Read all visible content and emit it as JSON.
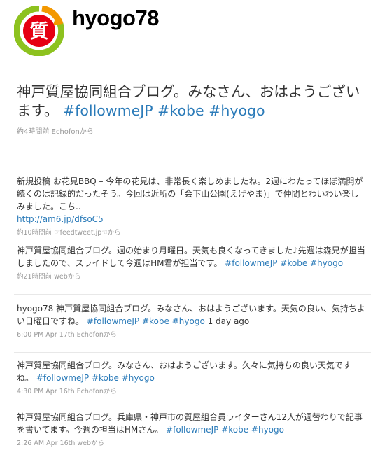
{
  "profile": {
    "screen_name": "hyogo78",
    "avatar_char": "質",
    "colors": {
      "ring_green": "#8dc21f",
      "ring_orange": "#f39800",
      "center_red": "#e60012"
    }
  },
  "featured": {
    "text_prefix": "神戸質屋協同組合ブログ。みなさん、おはようございます。",
    "tags": [
      "#followmeJP",
      "#kobe",
      "#hyogo"
    ],
    "meta": "約4時間前 Echofonから"
  },
  "tweets": [
    {
      "text": "新規投稿 お花見BBQ – 今年の花見は、非常長く楽しめましたね。2週にわたってほぼ満開が続くのは記録的だったそう。今回は近所の「会下山公園(えげやま)」で仲間とわいわい楽しみました。こち..",
      "link": "http://am6.jp/dfsoC5",
      "meta": "約10時間前 ☞feedtweet.jp☜から"
    },
    {
      "text": "神戸質屋協同組合ブログ。週の始まり月曜日。天気も良くなってきました♪先週は森兄が担当しましたので、スライドして今週はHM君が担当です。",
      "tags": [
        "#followmeJP",
        "#kobe",
        "#hyogo"
      ],
      "meta": "約21時間前 webから"
    },
    {
      "text": "hyogo78 神戸質屋協同組合ブログ。みなさん、おはようございます。天気の良い、気持ちよい日曜日ですね。",
      "tags": [
        "#followmeJP",
        "#kobe",
        "#hyogo"
      ],
      "suffix": "1 day ago",
      "meta": "6:00 PM Apr 17th Echofonから"
    },
    {
      "text": "神戸質屋協同組合ブログ。みなさん、おはようございます。久々に気持ちの良い天気ですね。",
      "tags": [
        "#followmeJP",
        "#kobe",
        "#hyogo"
      ],
      "meta": "4:30 PM Apr 16th Echofonから"
    },
    {
      "text": "神戸質屋協同組合ブログ。兵庫県・神戸市の質屋組合員ライターさん12人が週替わりで記事を書いてます。今週の担当はHMさん。",
      "tags": [
        "#followmeJP",
        "#kobe",
        "#hyogo"
      ],
      "meta": "2:26 AM Apr 16th webから"
    }
  ]
}
